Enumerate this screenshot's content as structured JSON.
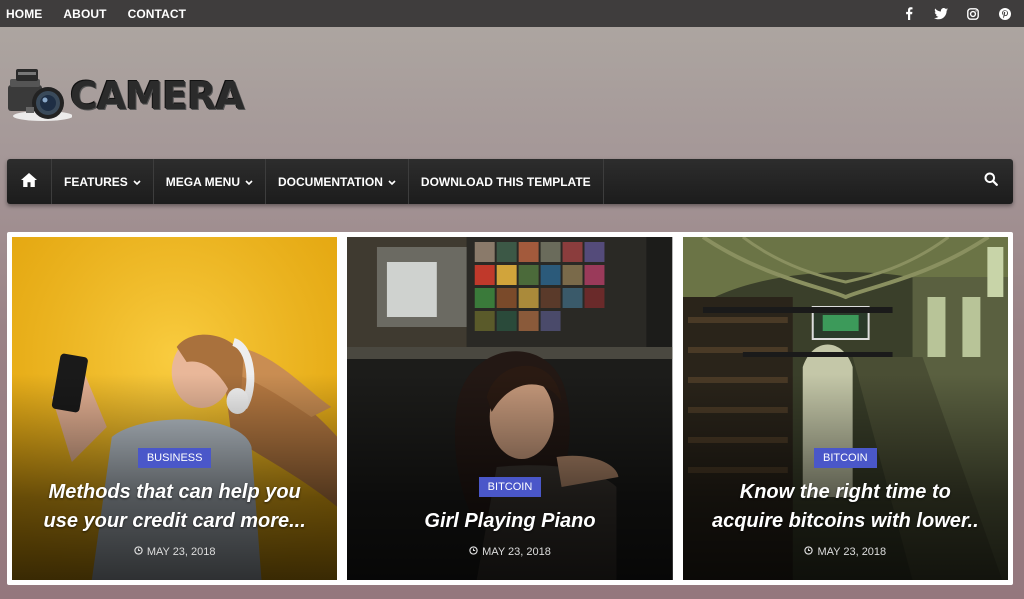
{
  "topnav": {
    "items": [
      "HOME",
      "ABOUT",
      "CONTACT"
    ]
  },
  "social": [
    "facebook-icon",
    "twitter-icon",
    "instagram-icon",
    "pinterest-icon"
  ],
  "logo": {
    "text": "CAMERA"
  },
  "mainnav": {
    "items": [
      {
        "label": "FEATURES",
        "dropdown": true
      },
      {
        "label": "MEGA MENU",
        "dropdown": true
      },
      {
        "label": "DOCUMENTATION",
        "dropdown": true
      },
      {
        "label": "DOWNLOAD THIS TEMPLATE",
        "dropdown": false
      }
    ]
  },
  "featured": [
    {
      "category": "BUSINESS",
      "title": "Methods that can help you use your credit card more...",
      "date": "MAY 23, 2018"
    },
    {
      "category": "BITCOIN",
      "title": "Girl Playing Piano",
      "date": "MAY 23, 2018"
    },
    {
      "category": "BITCOIN",
      "title": "Know the right time to acquire bitcoins with lower..",
      "date": "MAY 23, 2018"
    }
  ],
  "colors": {
    "topbar": "#3f3d3d",
    "nav": "#222222",
    "badge": "#4a57c9"
  }
}
